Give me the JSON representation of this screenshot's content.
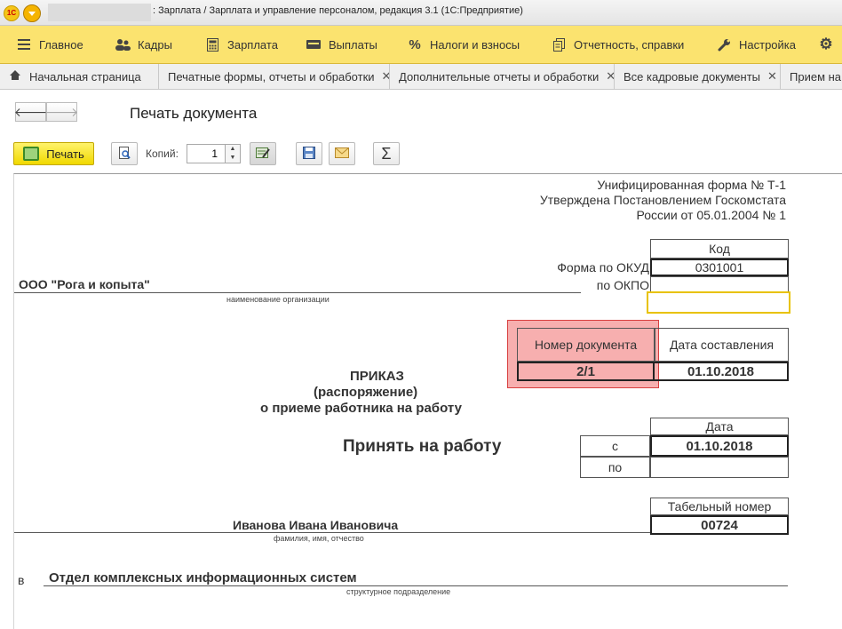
{
  "window": {
    "logo": "1С",
    "title": ": Зарплата / Зарплата и управление персоналом, редакция 3.1  (1С:Предприятие)"
  },
  "sections": [
    {
      "label": "Главное",
      "icon": "hamburger-icon"
    },
    {
      "label": "Кадры",
      "icon": "people-icon"
    },
    {
      "label": "Зарплата",
      "icon": "calculator-icon"
    },
    {
      "label": "Выплаты",
      "icon": "wallet-icon"
    },
    {
      "label": "Налоги и взносы",
      "icon": "percent-icon"
    },
    {
      "label": "Отчетность, справки",
      "icon": "report-icon"
    },
    {
      "label": "Настройка",
      "icon": "wrench-icon"
    }
  ],
  "tabs": [
    {
      "label": "Начальная страница"
    },
    {
      "label": "Печатные формы, отчеты и обработки"
    },
    {
      "label": "Дополнительные отчеты и обработки"
    },
    {
      "label": "Все кадровые документы"
    },
    {
      "label": "Прием на"
    }
  ],
  "header": {
    "title": "Печать документа"
  },
  "toolbar": {
    "print_label": "Печать",
    "copies_label": "Копий:",
    "copies_value": "1"
  },
  "document": {
    "form_line1": "Унифицированная форма № Т-1",
    "form_line2": "Утверждена Постановлением Госкомстата",
    "form_line3": "России от 05.01.2004 № 1",
    "code_header": "Код",
    "okud_label": "Форма по ОКУД",
    "okud_value": "0301001",
    "okpo_label": "по ОКПО",
    "organization": "ООО \"Рога и копыта\"",
    "organization_caption": "наименование организации",
    "doc_number_header": "Номер документа",
    "doc_date_header": "Дата составления",
    "doc_number": "2/1",
    "doc_date": "01.10.2018",
    "order_title1": "ПРИКАЗ",
    "order_title2": "(распоряжение)",
    "order_title3": "о приеме работника на работу",
    "hire_title": "Принять на работу",
    "period_date_header": "Дата",
    "period_from_label": "с",
    "period_from_value": "01.10.2018",
    "period_to_label": "по",
    "tab_number_header": "Табельный номер",
    "tab_number": "00724",
    "employee_name": "Иванова Ивана Ивановича",
    "employee_caption": "фамилия, имя, отчество",
    "in_label": "в",
    "department": "Отдел комплексных информационных систем",
    "department_caption": "структурное подразделение"
  }
}
